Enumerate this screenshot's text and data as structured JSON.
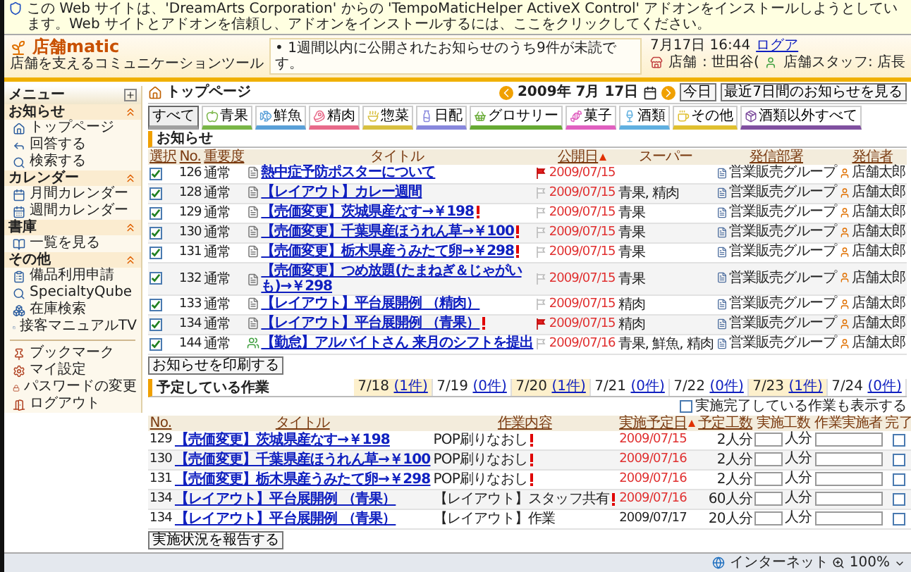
{
  "infobar": {
    "text": "この Web サイトは、'DreamArts Corporation' からの 'TempoMaticHelper ActiveX Control' アドオンをインストールしようとしています。Web サイトとアドオンを信頼し、アドオンをインストールするには、ここをクリックしてください。"
  },
  "header": {
    "logo": "店舗matic",
    "tagline": "店舗を支えるコミュニケーションツール",
    "notice": "• 1週間以内に公開されたお知らせのうち9件が未読です。",
    "datetime": "7月17日 16:44",
    "logout_link": "ログア",
    "store_label": "店舗",
    "store_value": ": 世田谷(",
    "staff": "店舗スタッフ: 店長"
  },
  "sidebar": {
    "title": "メニュー",
    "sections": [
      {
        "title": "お知らせ",
        "expanded": true,
        "items": [
          "トップページ",
          "回答する",
          "検索する"
        ]
      },
      {
        "title": "カレンダー",
        "expanded": true,
        "items": [
          "月間カレンダー",
          "週間カレンダー"
        ]
      },
      {
        "title": "書庫",
        "expanded": true,
        "items": [
          "一覧を見る"
        ]
      },
      {
        "title": "その他",
        "expanded": true,
        "items": [
          "備品利用申請",
          "SpecialtyQube",
          "在庫検索",
          "接客マニュアルTV"
        ]
      }
    ],
    "extra_items": [
      "ブックマーク",
      "マイ設定",
      "パスワードの変更",
      "ログアウト"
    ]
  },
  "toolbar": {
    "page_title": "トップページ",
    "date": "2009年 7月 17日",
    "buttons": [
      "今日",
      "最近7日間のお知らせを見る"
    ]
  },
  "categories": [
    {
      "label": "すべて",
      "selected": true,
      "color": "#a0a0a0"
    },
    {
      "label": "青果",
      "selected": false,
      "color": "#7ab648"
    },
    {
      "label": "鮮魚",
      "selected": false,
      "color": "#5aa0d8"
    },
    {
      "label": "精肉",
      "selected": false,
      "color": "#e86a8a"
    },
    {
      "label": "惣菜",
      "selected": false,
      "color": "#d8c040"
    },
    {
      "label": "日配",
      "selected": false,
      "color": "#8888dd"
    },
    {
      "label": "グロサリー",
      "selected": false,
      "color": "#66aa33"
    },
    {
      "label": "菓子",
      "selected": false,
      "color": "#e060c0"
    },
    {
      "label": "酒類",
      "selected": false,
      "color": "#60b0e0"
    },
    {
      "label": "その他",
      "selected": false,
      "color": "#e0c030"
    },
    {
      "label": "酒類以外すべて",
      "selected": false,
      "color": "#8050a0"
    }
  ],
  "notices": {
    "title": "お知らせ",
    "columns": [
      {
        "label": "選択",
        "sorted": false
      },
      {
        "label": "No.",
        "sorted": false
      },
      {
        "label": "重要度",
        "sorted": false
      },
      {
        "label": "タイトル",
        "sorted": false
      },
      {
        "label": "公開日",
        "sorted": true
      },
      {
        "label": "スーパー",
        "sorted": false
      },
      {
        "label": "発信部署",
        "sorted": false
      },
      {
        "label": "発信者",
        "sorted": false
      }
    ],
    "rows": [
      {
        "checked": true,
        "no": "126",
        "priority": "通常",
        "kind": "document",
        "title": "熱中症予防ポスターについて",
        "urgent": false,
        "flagged": true,
        "date": "2009/07/15",
        "dept": "営業販売グループ",
        "sender": "店舗太郎"
      },
      {
        "checked": true,
        "no": "128",
        "priority": "通常",
        "kind": "document",
        "title": "【レイアウト】カレー週間",
        "urgent": false,
        "flagged": false,
        "date": "2009/07/15",
        "stores": "青果, 精肉",
        "dept": "営業販売グループ",
        "sender": "店舗太郎"
      },
      {
        "checked": true,
        "no": "129",
        "priority": "通常",
        "kind": "document",
        "title": "【売価変更】茨城県産なす→￥198",
        "urgent": true,
        "flagged": false,
        "date": "2009/07/15",
        "stores": "青果",
        "dept": "営業販売グループ",
        "sender": "店舗太郎"
      },
      {
        "checked": true,
        "no": "130",
        "priority": "通常",
        "kind": "document",
        "title": "【売価変更】千葉県産ほうれん草→￥100",
        "urgent": true,
        "flagged": false,
        "date": "2009/07/15",
        "stores": "青果",
        "dept": "営業販売グループ",
        "sender": "店舗太郎"
      },
      {
        "checked": true,
        "no": "131",
        "priority": "通常",
        "kind": "document",
        "title": "【売価変更】栃木県産うみたて卵→￥298",
        "urgent": true,
        "flagged": false,
        "date": "2009/07/15",
        "stores": "青果",
        "dept": "営業販売グループ",
        "sender": "店舗太郎"
      },
      {
        "checked": true,
        "no": "132",
        "priority": "通常",
        "kind": "document",
        "title": "【売価変更】つめ放題(たまねぎ＆じゃがいも)→￥298",
        "urgent": false,
        "flagged": false,
        "date": "2009/07/15",
        "stores": "青果",
        "dept": "営業販売グループ",
        "sender": "店舗太郎"
      },
      {
        "checked": true,
        "no": "133",
        "priority": "通常",
        "kind": "document",
        "title": "【レイアウト】平台展開例 （精肉）",
        "urgent": false,
        "flagged": false,
        "date": "2009/07/15",
        "stores": "精肉",
        "dept": "営業販売グループ",
        "sender": "店舗太郎"
      },
      {
        "checked": true,
        "no": "134",
        "priority": "通常",
        "kind": "document",
        "title": "【レイアウト】平台展開例 （青果）",
        "urgent": true,
        "flagged": true,
        "date": "2009/07/15",
        "stores": "精肉",
        "dept": "営業販売グループ",
        "sender": "店舗太郎"
      },
      {
        "checked": true,
        "no": "144",
        "priority": "通常",
        "kind": "attendance",
        "title": "【勤怠】アルバイトさん 来月のシフトを提出",
        "urgent": false,
        "flagged": false,
        "date": "2009/07/16",
        "stores": "青果, 鮮魚, 精肉",
        "dept": "営業販売グループ",
        "sender": "店舗太郎"
      }
    ],
    "print_button": "お知らせを印刷する"
  },
  "tasks": {
    "title": "予定している作業",
    "days": [
      {
        "date": "7/18",
        "count": "(1件)",
        "highlighted": true
      },
      {
        "date": "7/19",
        "count": "(0件)",
        "highlighted": false
      },
      {
        "date": "7/20",
        "count": "(1件)",
        "highlighted": true
      },
      {
        "date": "7/21",
        "count": "(0件)",
        "highlighted": false
      },
      {
        "date": "7/22",
        "count": "(0件)",
        "highlighted": false
      },
      {
        "date": "7/23",
        "count": "(1件)",
        "highlighted": true
      },
      {
        "date": "7/24",
        "count": "(0件)",
        "highlighted": false
      }
    ],
    "show_done": {
      "label": "実施完了している作業も表示する",
      "checked": false
    },
    "columns": [
      {
        "label": "No.",
        "sorted": false
      },
      {
        "label": "タイトル",
        "sorted": false
      },
      {
        "label": "作業内容",
        "sorted": false
      },
      {
        "label": "実施予定日",
        "sorted": true
      },
      {
        "label": "予定工数",
        "sorted": false
      },
      {
        "label": "実施工数",
        "sorted": false
      },
      {
        "label": "作業実施者",
        "sorted": false
      },
      {
        "label": "完了",
        "sorted": false
      }
    ],
    "rows": [
      {
        "no": "129",
        "title": "【売価変更】茨城県産なす→￥198",
        "work": "POP刷りなおし",
        "urgent": true,
        "date": "2009/07/15",
        "overdue": true,
        "planned": "2人分",
        "unit": "人分",
        "done": false
      },
      {
        "no": "130",
        "title": "【売価変更】千葉県産ほうれん草→￥100",
        "work": "POP刷りなおし",
        "urgent": true,
        "date": "2009/07/16",
        "overdue": true,
        "planned": "2人分",
        "unit": "人分",
        "done": false
      },
      {
        "no": "131",
        "title": "【売価変更】栃木県産うみたて卵→￥298",
        "work": "POP刷りなおし",
        "urgent": true,
        "date": "2009/07/16",
        "overdue": true,
        "planned": "2人分",
        "unit": "人分",
        "done": false
      },
      {
        "no": "134",
        "title": "【レイアウト】平台展開例 （青果）",
        "work": "【レイアウト】スタッフ共有",
        "urgent": true,
        "date": "2009/07/16",
        "overdue": true,
        "planned": "60人分",
        "unit": "人分",
        "done": false
      },
      {
        "no": "134",
        "title": "【レイアウト】平台展開例 （青果）",
        "work": "【レイアウト】作業",
        "urgent": false,
        "date": "2009/07/17",
        "overdue": false,
        "planned": "20人分",
        "unit": "人分",
        "done": false
      }
    ],
    "report_button": "実施状況を報告する"
  },
  "status_bar": {
    "zone": "インターネット",
    "zoom": "100%"
  }
}
